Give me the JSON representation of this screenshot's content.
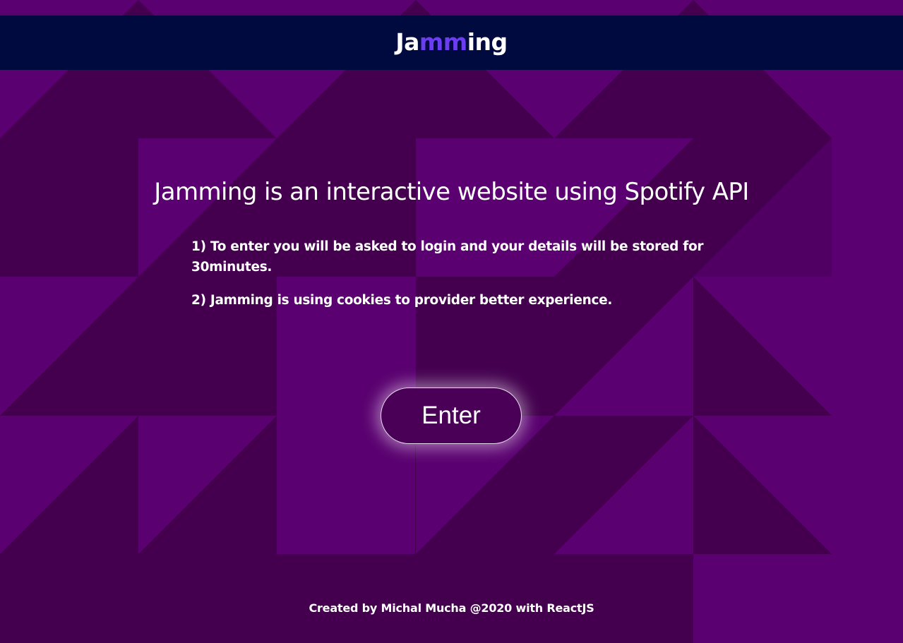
{
  "header": {
    "logo_start": "Ja",
    "logo_accent": "mm",
    "logo_end": "ing"
  },
  "main": {
    "headline": "Jamming is an interactive website using Spotify API",
    "info_items": [
      "1) To enter you will be asked to login and your details will be stored for 30minutes.",
      "2) Jamming is using cookies to provider better experience."
    ],
    "enter_label": "Enter"
  },
  "footer": {
    "credit": "Created by Michal Mucha @2020 with ReactJS"
  },
  "colors": {
    "header_bg": "#000a3e",
    "background_dark": "#44004f",
    "background_light": "#5a0070",
    "logo_accent": "#6b3cf0"
  }
}
